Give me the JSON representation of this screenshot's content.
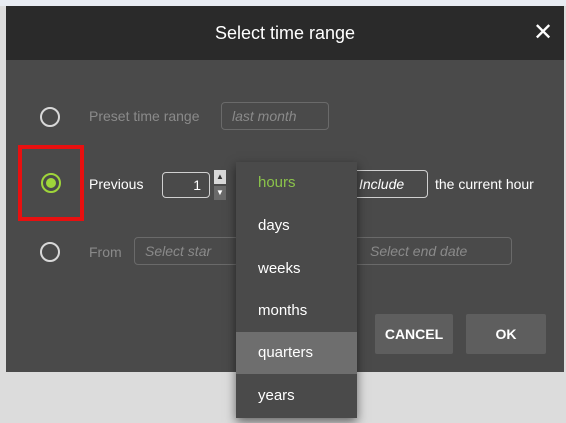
{
  "dialog": {
    "title": "Select time range",
    "close_icon": "close-icon"
  },
  "options": {
    "preset": {
      "label": "Preset time range",
      "value": "last month",
      "selected": false
    },
    "previous": {
      "label": "Previous",
      "count": "1",
      "unit_selected": "hours",
      "include_button": "Include",
      "suffix": "the current hour",
      "selected": true
    },
    "from": {
      "label": "From",
      "start_placeholder": "Select star",
      "end_placeholder": "Select end date",
      "selected": false
    }
  },
  "unit_dropdown": {
    "items": [
      "hours",
      "days",
      "weeks",
      "months",
      "quarters",
      "years"
    ],
    "selected": "hours",
    "hovered": "quarters"
  },
  "buttons": {
    "cancel": "CANCEL",
    "ok": "OK"
  },
  "colors": {
    "accent_green": "#9fd53a",
    "highlight_red": "#e81010",
    "header_bg": "#2a2a2a",
    "dialog_bg": "#4a4a4a"
  }
}
